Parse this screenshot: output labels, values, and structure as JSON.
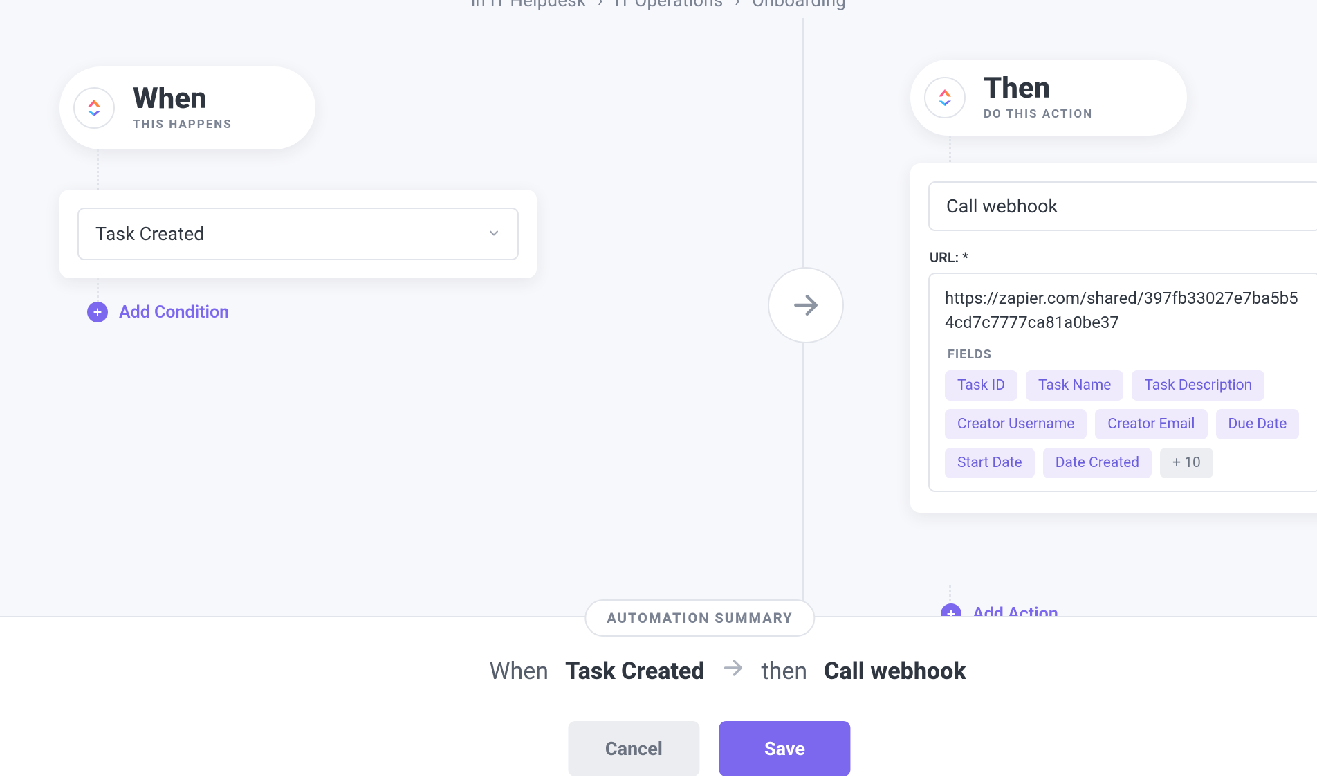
{
  "breadcrumb": [
    "IT Helpdesk",
    "IT Operations",
    "Onboarding"
  ],
  "breadcrumb_prefix": "in",
  "when": {
    "title": "When",
    "subtitle": "THIS HAPPENS",
    "trigger_selected": "Task Created",
    "add_condition_label": "Add Condition"
  },
  "then": {
    "title": "Then",
    "subtitle": "DO THIS ACTION",
    "action_selected": "Call webhook",
    "url_label": "URL: *",
    "url_value": "https://zapier.com/shared/397fb33027e7ba5b54cd7c7777ca81a0be37",
    "fields_label": "FIELDS",
    "fields": [
      "Task ID",
      "Task Name",
      "Task Description",
      "Creator Username",
      "Creator Email",
      "Due Date",
      "Start Date",
      "Date Created"
    ],
    "fields_more": "+ 10",
    "add_action_label": "Add Action"
  },
  "footer": {
    "summary_label": "AUTOMATION SUMMARY",
    "summary": {
      "when_prefix": "When",
      "when_bold": "Task Created",
      "then_prefix": "then",
      "then_bold": "Call webhook"
    },
    "cancel": "Cancel",
    "save": "Save"
  }
}
